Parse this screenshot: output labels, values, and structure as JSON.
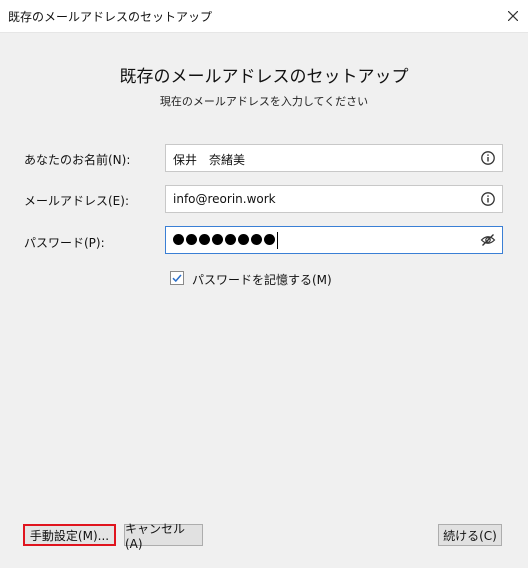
{
  "window": {
    "title": "既存のメールアドレスのセットアップ"
  },
  "header": {
    "title": "既存のメールアドレスのセットアップ",
    "subtitle": "現在のメールアドレスを入力してください"
  },
  "form": {
    "name": {
      "label": "あなたのお名前(N):",
      "value": "保井　奈緒美"
    },
    "email": {
      "label": "メールアドレス(E):",
      "value": "info@reorin.work"
    },
    "password": {
      "label": "パスワード(P):",
      "masked_length": 8
    },
    "remember": {
      "label": "パスワードを記憶する(M)",
      "checked": true
    }
  },
  "buttons": {
    "manual": "手動設定(M)...",
    "cancel": "キャンセル(A)",
    "continue": "続ける(C)"
  },
  "colors": {
    "focus_border": "#3a7fd5",
    "manual_highlight": "#e0141e"
  }
}
